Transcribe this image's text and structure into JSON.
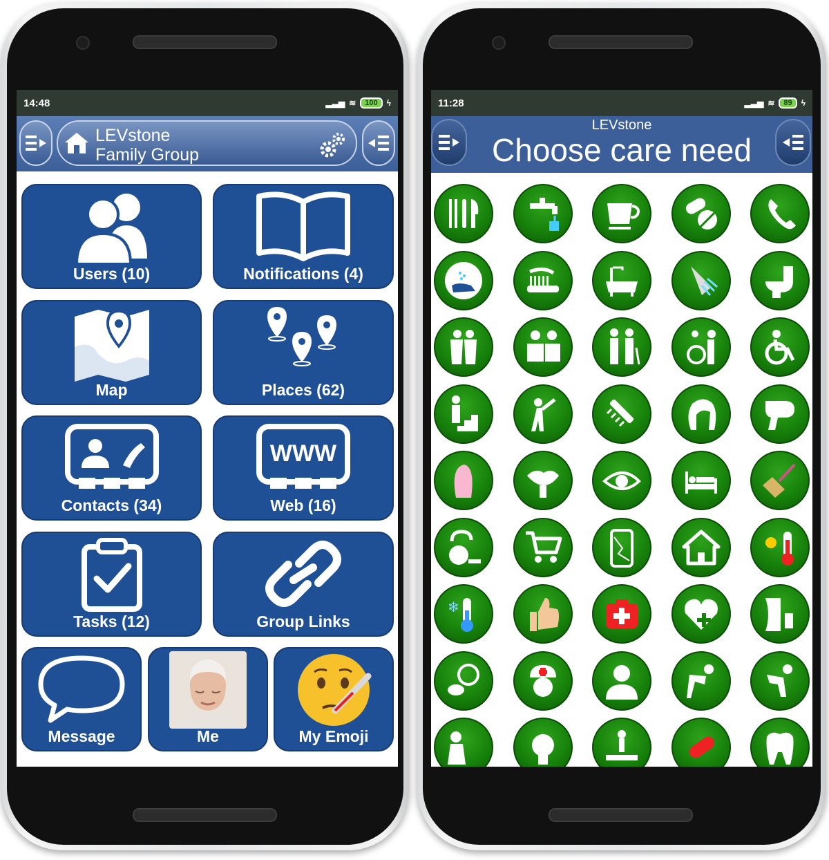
{
  "left_phone": {
    "status": {
      "time": "14:48",
      "battery": "100"
    },
    "header": {
      "title_line1": "LEVstone",
      "title_line2": "Family Group"
    },
    "tiles": [
      {
        "label": "Users (10)",
        "icon": "users-icon"
      },
      {
        "label": "Notifications (4)",
        "icon": "book-icon"
      },
      {
        "label": "Map",
        "icon": "map-icon"
      },
      {
        "label": "Places (62)",
        "icon": "places-icon"
      },
      {
        "label": "Contacts (34)",
        "icon": "contacts-icon"
      },
      {
        "label": "Web (16)",
        "icon": "web-icon"
      },
      {
        "label": "Tasks (12)",
        "icon": "tasks-icon"
      },
      {
        "label": "Group Links",
        "icon": "link-icon"
      }
    ],
    "bottom_tiles": [
      {
        "label": "Message",
        "icon": "speech-bubble-icon"
      },
      {
        "label": "Me",
        "icon": "avatar-photo"
      },
      {
        "label": "My Emoji",
        "icon": "sick-emoji-icon"
      }
    ],
    "web_icon_text": "WWW"
  },
  "right_phone": {
    "status": {
      "time": "11:28",
      "battery": "89"
    },
    "header": {
      "subtitle": "LEVstone",
      "title": "Choose care need"
    },
    "care_icons": [
      "cutlery-icon",
      "tap-water-icon",
      "cup-icon",
      "pills-icon",
      "phone-icon",
      "handwash-icon",
      "toothbrush-icon",
      "bath-icon",
      "shower-icon",
      "toilet-icon",
      "hug-icon",
      "help-person-icon",
      "walking-assist-icon",
      "wheelchair-assist-icon",
      "wheelchair-icon",
      "stairs-icon",
      "stretch-icon",
      "comb-icon",
      "hair-icon",
      "hairdryer-icon",
      "nail-icon",
      "lips-icon",
      "eye-icon",
      "bed-icon",
      "broom-icon",
      "vacuum-icon",
      "shopping-cart-icon",
      "broken-phone-icon",
      "home-icon",
      "hot-thermometer-icon",
      "cold-thermometer-icon",
      "thumbs-up-icon",
      "first-aid-icon",
      "heart-plus-icon",
      "inhaler-icon",
      "blood-pressure-icon",
      "nurse-icon",
      "doctor-icon",
      "back-pain-icon",
      "stomach-pain-icon",
      "cough-icon",
      "headache-icon",
      "bed-exit-icon",
      "capsule-icon",
      "tooth-icon"
    ]
  }
}
